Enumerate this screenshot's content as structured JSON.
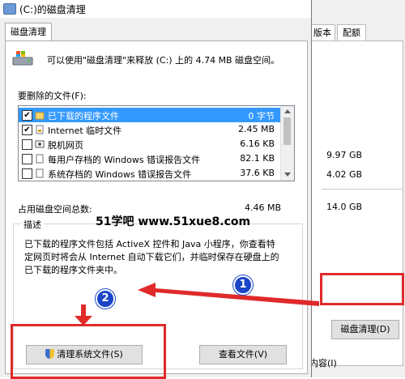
{
  "background_window": {
    "tabs": [
      "版本",
      "配额"
    ],
    "values": [
      "9.97 GB",
      "4.02 GB",
      "14.0 GB"
    ],
    "button_label": "磁盘清理(D)",
    "footer_text": "内容(I)"
  },
  "dialog": {
    "title": "(C:)的磁盘清理",
    "tab_label": "磁盘清理",
    "description": "可以使用\"磁盘清理\"来释放 (C:) 上的 4.74 MB 磁盘空间。",
    "files_label": "要删除的文件(F):",
    "files": [
      {
        "name": "已下载的程序文件",
        "size": "0 字节",
        "checked": true,
        "selected": true
      },
      {
        "name": "Internet 临时文件",
        "size": "2.45 MB",
        "checked": true,
        "selected": false
      },
      {
        "name": "脱机网页",
        "size": "6.16 KB",
        "checked": false,
        "selected": false
      },
      {
        "name": "每用户存档的 Windows 错误报告文件",
        "size": "82.1 KB",
        "checked": false,
        "selected": false
      },
      {
        "name": "系统存档的 Windows 错误报告文件",
        "size": "37.6 KB",
        "checked": false,
        "selected": false
      }
    ],
    "total_label": "占用磁盘空间总数:",
    "total_value": "4.46 MB",
    "group_label": "描述",
    "group_text": "已下载的程序文件包括 ActiveX 控件和 Java 小程序，你查看特定网页时将会从 Internet 自动下载它们，并临时保存在硬盘上的已下载的程序文件夹中。",
    "clean_system_button": "清理系统文件(S)",
    "view_files_button": "查看文件(V)"
  },
  "annotations": {
    "watermark": "51学吧 www.51xue8.com",
    "badge1": "1",
    "badge2": "2",
    "accent_red": "#e02a2a",
    "badge_blue": "#1b45c8"
  }
}
